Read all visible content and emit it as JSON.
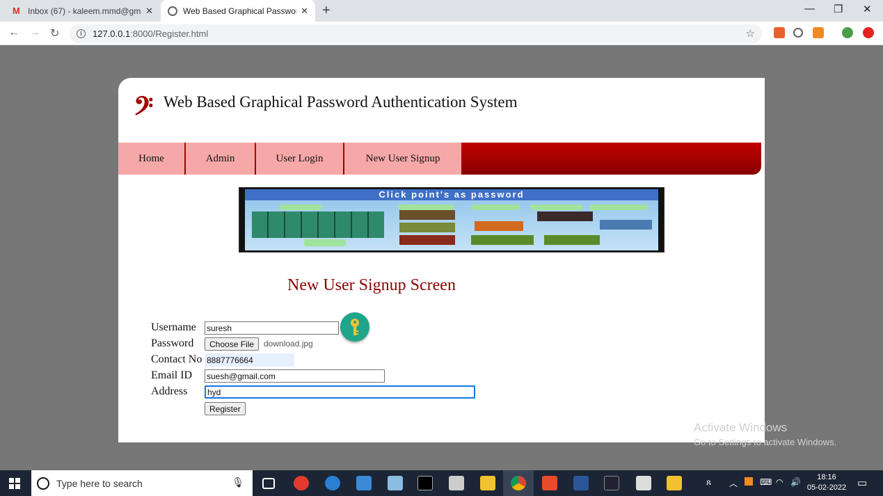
{
  "browser": {
    "tabs": [
      {
        "title": "Inbox (67) - kaleem.mmd@gmail"
      },
      {
        "title": "Web Based Graphical Password A"
      }
    ],
    "url_host": "127.0.0.1",
    "url_path": ":8000/Register.html"
  },
  "site": {
    "title": "Web Based Graphical Password Authentication System",
    "menu": [
      "Home",
      "Admin",
      "User Login",
      "New User Signup"
    ],
    "banner_text": "Click point's as password"
  },
  "form": {
    "title": "New User Signup Screen",
    "username_label": "Username",
    "username_value": "suresh",
    "password_label": "Password",
    "choose_file_label": "Choose File",
    "file_name": "download.jpg",
    "contact_label": "Contact No",
    "contact_value": "8887776664",
    "email_label": "Email ID",
    "email_value": "suesh@gmail.com",
    "address_label": "Address",
    "address_value": "hyd",
    "register_label": "Register"
  },
  "watermark": {
    "line1": "Activate Windows",
    "line2": "Go to Settings to activate Windows."
  },
  "taskbar": {
    "search_placeholder": "Type here to search",
    "time": "18:16",
    "date": "05-02-2022"
  },
  "colors": {
    "accent": "#a00000",
    "menu_bg": "#f6a8a8",
    "page_bg": "#777777"
  }
}
